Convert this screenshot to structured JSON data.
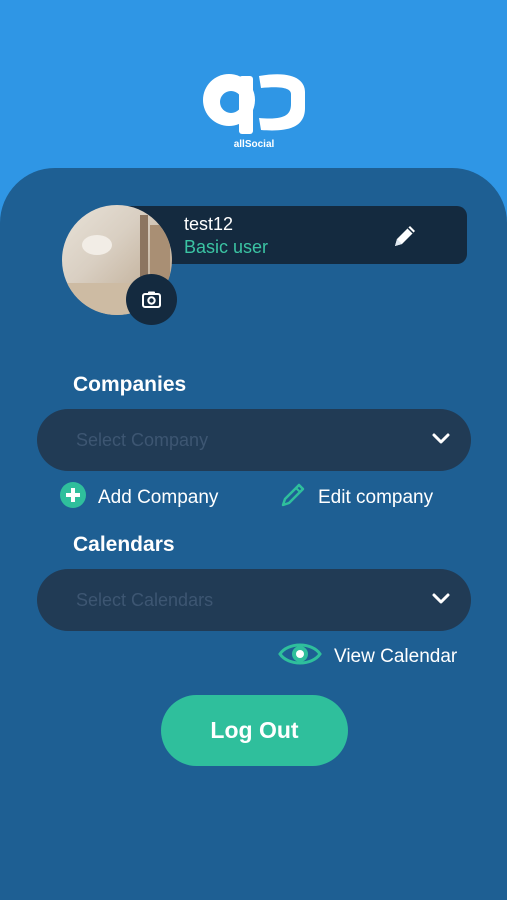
{
  "brand": {
    "name": "allSocial"
  },
  "profile": {
    "username": "test12",
    "role": "Basic user"
  },
  "companies": {
    "title": "Companies",
    "select_placeholder": "Select Company",
    "add_label": "Add Company",
    "edit_label": "Edit company"
  },
  "calendars": {
    "title": "Calendars",
    "select_placeholder": "Select Calendars",
    "view_label": "View Calendar"
  },
  "actions": {
    "logout_label": "Log Out"
  },
  "colors": {
    "background": "#2f96e5",
    "card": "#1e5f93",
    "dark": "#142a3f",
    "accent": "#2fbf9c",
    "role_text": "#3bc4a3"
  },
  "icons": [
    "logo-icon",
    "pencil-icon",
    "camera-icon",
    "chevron-down-icon",
    "plus-circle-icon",
    "edit-pencil-icon",
    "eye-icon"
  ]
}
